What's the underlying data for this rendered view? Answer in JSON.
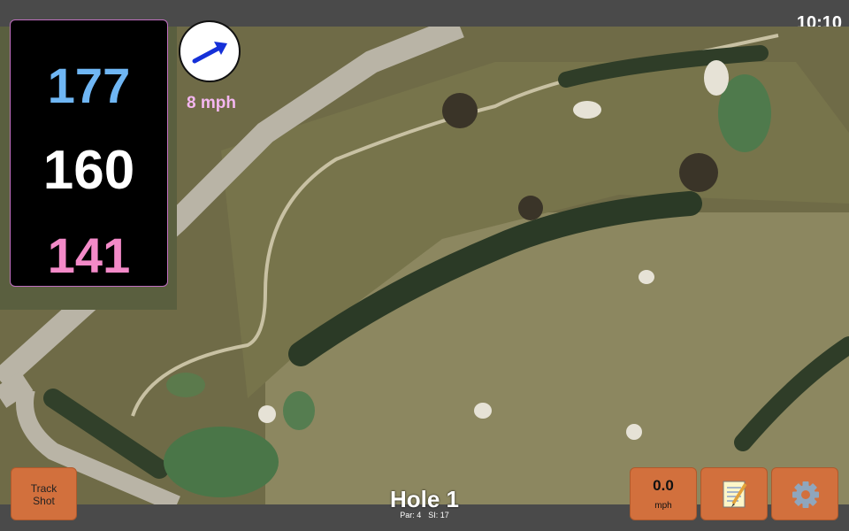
{
  "status": {
    "time": "10:10"
  },
  "distances": {
    "back": "177",
    "middle": "160",
    "front": "141"
  },
  "wind": {
    "speed": "8 mph",
    "icon": "wind-arrow-icon"
  },
  "hole": {
    "title": "Hole 1",
    "par": "Par: 4",
    "si": "SI: 17"
  },
  "buttons": {
    "track_shot": {
      "line1": "Track",
      "line2": "Shot"
    },
    "speed": {
      "value": "0.0",
      "unit": "mph"
    },
    "notes": {
      "icon": "notepad-icon"
    },
    "settings": {
      "icon": "gear-icon"
    }
  },
  "colors": {
    "back": "#6fb6f4",
    "middle": "#ffffff",
    "front": "#f38ac8",
    "accent": "#d2703d",
    "wind_label": "#f4b6f0",
    "arrow": "#1530d8"
  }
}
